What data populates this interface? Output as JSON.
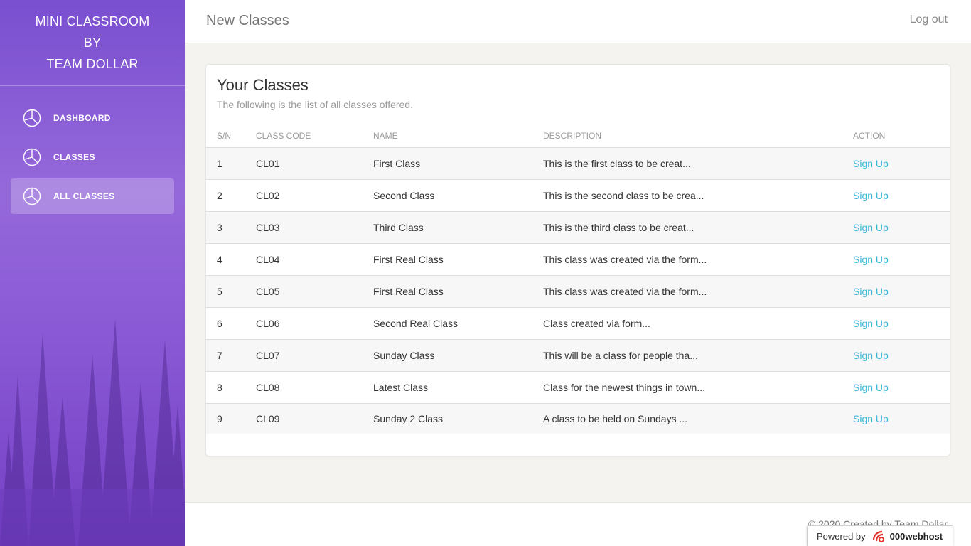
{
  "sidebar": {
    "brand_lines": [
      "MINI CLASSROOM",
      "BY",
      "TEAM DOLLAR"
    ],
    "items": [
      {
        "label": "DASHBOARD",
        "icon": "pie-chart-icon",
        "active": false
      },
      {
        "label": "CLASSES",
        "icon": "pie-chart-icon",
        "active": false
      },
      {
        "label": "ALL CLASSES",
        "icon": "pie-chart-icon",
        "active": true
      }
    ]
  },
  "header": {
    "title": "New Classes",
    "logout_label": "Log out"
  },
  "card": {
    "title": "Your Classes",
    "subtitle": "The following is the list of all classes offered.",
    "columns": [
      "S/N",
      "CLASS CODE",
      "NAME",
      "DESCRIPTION",
      "ACTION"
    ],
    "rows": [
      {
        "sn": "1",
        "code": "CL01",
        "name": "First Class",
        "description": "This is the first class to be creat...",
        "action": "Sign Up"
      },
      {
        "sn": "2",
        "code": "CL02",
        "name": "Second Class",
        "description": "This is the second class to be crea...",
        "action": "Sign Up"
      },
      {
        "sn": "3",
        "code": "CL03",
        "name": "Third Class",
        "description": "This is the third class to be creat...",
        "action": "Sign Up"
      },
      {
        "sn": "4",
        "code": "CL04",
        "name": "First Real Class",
        "description": "This class was created via the form...",
        "action": "Sign Up"
      },
      {
        "sn": "5",
        "code": "CL05",
        "name": "First Real Class",
        "description": "This class was created via the form...",
        "action": "Sign Up"
      },
      {
        "sn": "6",
        "code": "CL06",
        "name": "Second Real Class",
        "description": "Class created via form...",
        "action": "Sign Up"
      },
      {
        "sn": "7",
        "code": "CL07",
        "name": "Sunday Class",
        "description": "This will be a class for people tha...",
        "action": "Sign Up"
      },
      {
        "sn": "8",
        "code": "CL08",
        "name": "Latest Class",
        "description": "Class for the newest things in town...",
        "action": "Sign Up"
      },
      {
        "sn": "9",
        "code": "CL09",
        "name": "Sunday 2 Class",
        "description": "A class to be held on Sundays ...",
        "action": "Sign Up"
      }
    ]
  },
  "footer": {
    "copyright": "© 2020 Created by Team Dollar"
  },
  "hosting_badge": {
    "powered_by": "Powered by",
    "host_name": "000webhost"
  },
  "colors": {
    "sidebar_purple": "#8a5ad6",
    "link_cyan": "#3bb8d8",
    "badge_red": "#e4322b"
  }
}
